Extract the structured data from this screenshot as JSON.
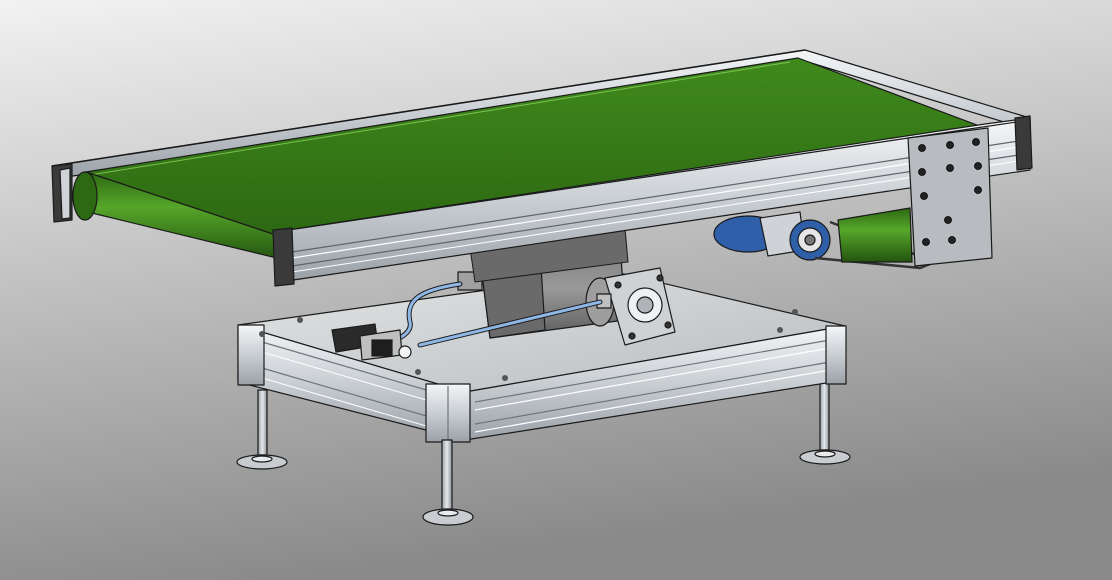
{
  "scene": {
    "subject": "belt-conveyor-cad-model",
    "colors": {
      "background_top": "#f2f2f2",
      "background_bottom": "#8a8a8a",
      "belt": "#3f8a1c",
      "belt_dark": "#2d6812",
      "aluminum": "#d8dde2",
      "aluminum_dark": "#8e969c",
      "edge": "#1a1a1a",
      "motor_blue": "#2e5fa8",
      "cylinder_gray": "#8e8e8e",
      "air_hose": "#8fb7e6",
      "base_plate": "#cfd2d4"
    },
    "icons": {
      "belt": "conveyor-belt-icon",
      "frame": "extrusion-frame-icon",
      "motor": "drive-motor-icon",
      "cylinder": "pneumatic-cylinder-icon",
      "valve": "solenoid-valve-icon",
      "feet": "leveling-foot-icon"
    }
  }
}
